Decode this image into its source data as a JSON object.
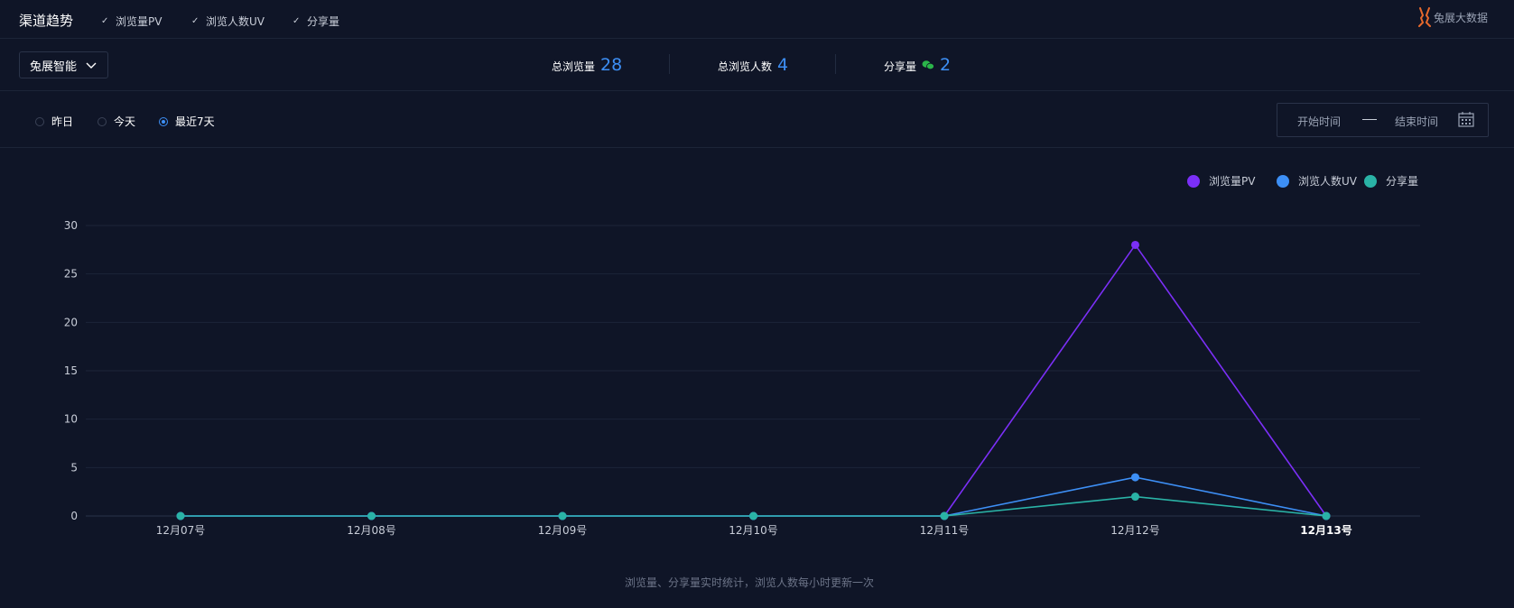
{
  "header": {
    "title": "渠道趋势",
    "checkboxes": [
      "浏览量PV",
      "浏览人数UV",
      "分享量"
    ],
    "brand": "兔展大数据"
  },
  "stats": {
    "selector": "兔展智能",
    "total_pv_label": "总浏览量",
    "total_pv": "28",
    "total_uv_label": "总浏览人数",
    "total_uv": "4",
    "share_label": "分享量",
    "share": "2"
  },
  "filters": {
    "options": [
      "昨日",
      "今天",
      "最近7天"
    ],
    "selected": "最近7天",
    "start_placeholder": "开始时间",
    "end_placeholder": "结束时间"
  },
  "chart_data": {
    "type": "line",
    "categories": [
      "12月07号",
      "12月08号",
      "12月09号",
      "12月10号",
      "12月11号",
      "12月12号",
      "12月13号"
    ],
    "ylim": [
      0,
      30
    ],
    "yticks": [
      0,
      5,
      10,
      15,
      20,
      25,
      30
    ],
    "legend_position": "top-right",
    "grid": true,
    "series": [
      {
        "name": "浏览量PV",
        "color": "#7b2ff7",
        "values": [
          0,
          0,
          0,
          0,
          0,
          28,
          0
        ]
      },
      {
        "name": "浏览人数UV",
        "color": "#3d8ff5",
        "values": [
          0,
          0,
          0,
          0,
          0,
          4,
          0
        ]
      },
      {
        "name": "分享量",
        "color": "#2ab3a6",
        "values": [
          0,
          0,
          0,
          0,
          0,
          2,
          0
        ]
      }
    ]
  },
  "footer_note": "浏览量、分享量实时统计，浏览人数每小时更新一次"
}
